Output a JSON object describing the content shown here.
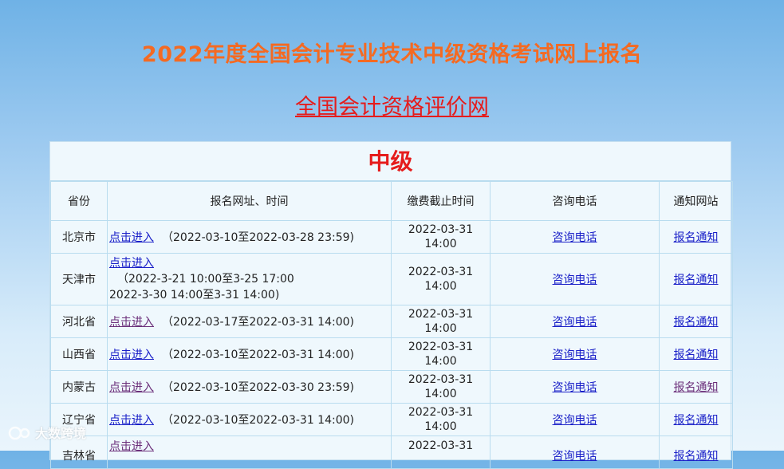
{
  "header": {
    "title": "2022年度全国会计专业技术中级资格考试网上报名",
    "site_link": "全国会计资格评价网"
  },
  "panel": {
    "level": "中级",
    "columns": [
      "省份",
      "报名网址、时间",
      "缴费截止时间",
      "咨询电话",
      "通知网站"
    ],
    "rows": [
      {
        "province": "北京市",
        "enter": "点击进入",
        "period": "（2022-03-10至2022-03-28 23:59)",
        "deadline_date": "2022-03-31",
        "deadline_time": "14:00",
        "phone": "咨询电话",
        "notice": "报名通知"
      },
      {
        "province": "天津市",
        "enter": "点击进入",
        "period": "（2022-3-21 10:00至3-25 17:00",
        "period2": "2022-3-30 14:00至3-31 14:00)",
        "deadline_date": "2022-03-31",
        "deadline_time": "14:00",
        "phone": "咨询电话",
        "notice": "报名通知"
      },
      {
        "province": "河北省",
        "enter": "点击进入",
        "period": "（2022-03-17至2022-03-31 14:00)",
        "deadline_date": "2022-03-31",
        "deadline_time": "14:00",
        "phone": "咨询电话",
        "notice": "报名通知"
      },
      {
        "province": "山西省",
        "enter": "点击进入",
        "period": "（2022-03-10至2022-03-31 14:00)",
        "deadline_date": "2022-03-31",
        "deadline_time": "14:00",
        "phone": "咨询电话",
        "notice": "报名通知"
      },
      {
        "province": "内蒙古",
        "enter": "点击进入",
        "period": "（2022-03-10至2022-03-30 23:59)",
        "deadline_date": "2022-03-31",
        "deadline_time": "14:00",
        "phone": "咨询电话",
        "notice": "报名通知"
      },
      {
        "province": "辽宁省",
        "enter": "点击进入",
        "period": "（2022-03-10至2022-03-31 14:00)",
        "deadline_date": "2022-03-31",
        "deadline_time": "14:00",
        "phone": "咨询电话",
        "notice": "报名通知"
      },
      {
        "province": "吉林省",
        "enter": "点击进入",
        "period": "",
        "deadline_date": "2022-03-31",
        "deadline_time": "",
        "phone": "咨询电话",
        "notice": "报名通知"
      }
    ]
  },
  "watermark": {
    "text": "大数跨境"
  },
  "colors": {
    "title": "#f46a22",
    "site_link": "#e51c1c",
    "level": "#e51c1c",
    "link": "#1a20c8",
    "visited_link": "#6b2f7a"
  }
}
